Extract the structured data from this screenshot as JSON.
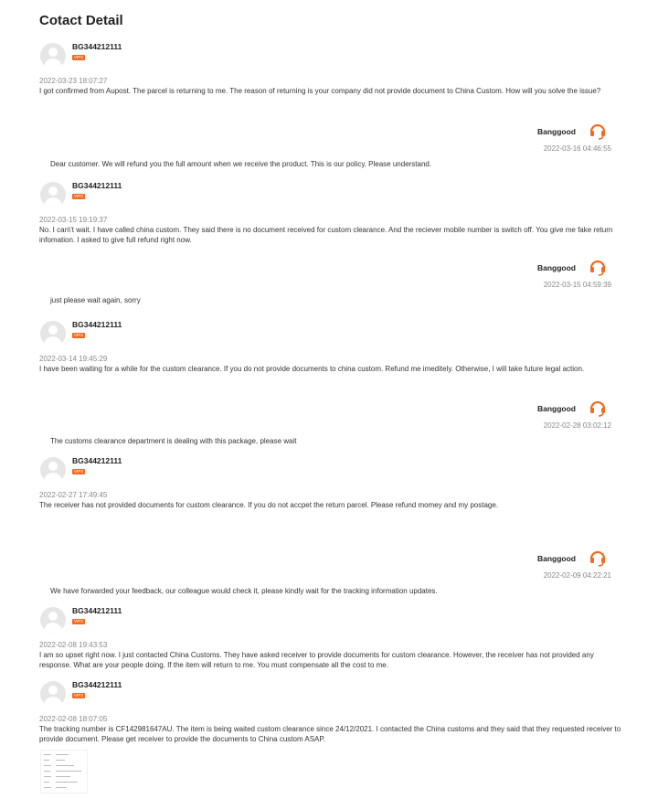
{
  "page": {
    "title": "Cotact Detail"
  },
  "user_name": "BG344212111",
  "vip_label": "VIP3",
  "staff_name": "Banggood",
  "messages": [
    {
      "from": "user",
      "time": "2022-03-23 18:07:27",
      "text": "I got confirmed from Aupost. The parcel is returning to me. The reason of returning is your company did not provide document to China Custom. How will you solve the issue?"
    },
    {
      "from": "staff",
      "time": "2022-03-16 04:46:55",
      "text": "Dear customer. We will refund you the full amount when we receive the product. This is our policy. Please understand."
    },
    {
      "from": "user",
      "time": "2022-03-15 19:19:37",
      "text": "No. I can\\'t wait. I have called china custom. They said there is no document received for custom clearance. And the reciever mobile number is switch off. You give me fake return infomation. I asked to give full refund right now."
    },
    {
      "from": "staff",
      "time": "2022-03-15 04:59:39",
      "text": "just please wait again, sorry"
    },
    {
      "from": "user",
      "time": "2022-03-14 19:45:29",
      "text": "I have been waiting for a while for the custom clearance. If you do not provide documents to china custom. Refund me imeditely. Otherwise, I will take future legal action."
    },
    {
      "from": "staff",
      "time": "2022-02-28 03:02:12",
      "text": "The customs clearance department is dealing with this package, please wait"
    },
    {
      "from": "user",
      "time": "2022-02-27 17:49:45",
      "text": "The receiver has not provided documents for custom clearance. If you do not accpet the return parcel. Please refund momey and my postage."
    },
    {
      "from": "staff",
      "time": "2022-02-09 04:22:21",
      "text": "We have forwarded your feedback, our colleague would check it, please kindly wait for the tracking information updates."
    },
    {
      "from": "user",
      "time": "2022-02-08 19:43:53",
      "text": "I am so upset right now. I just contacted China Customs. They have asked receiver to provide documents for custom clearance. However, the receiver has not provided any response. What are your people doing. If the item will return to me. You must compensate all the cost to me."
    },
    {
      "from": "user",
      "time": "2022-02-08 18:07:05",
      "text": "The tracking number is CF142981647AU. The item is being waited custom clearance since 24/12/2021. I contacted the China customs and they said that they requested receiver to provide document. Please get receiver to provide the documents to China custom ASAP."
    }
  ],
  "colors": {
    "accent": "#f26a21",
    "muted": "#888888"
  },
  "icons": {
    "avatar": "user-avatar-icon",
    "staff": "headset-icon"
  }
}
